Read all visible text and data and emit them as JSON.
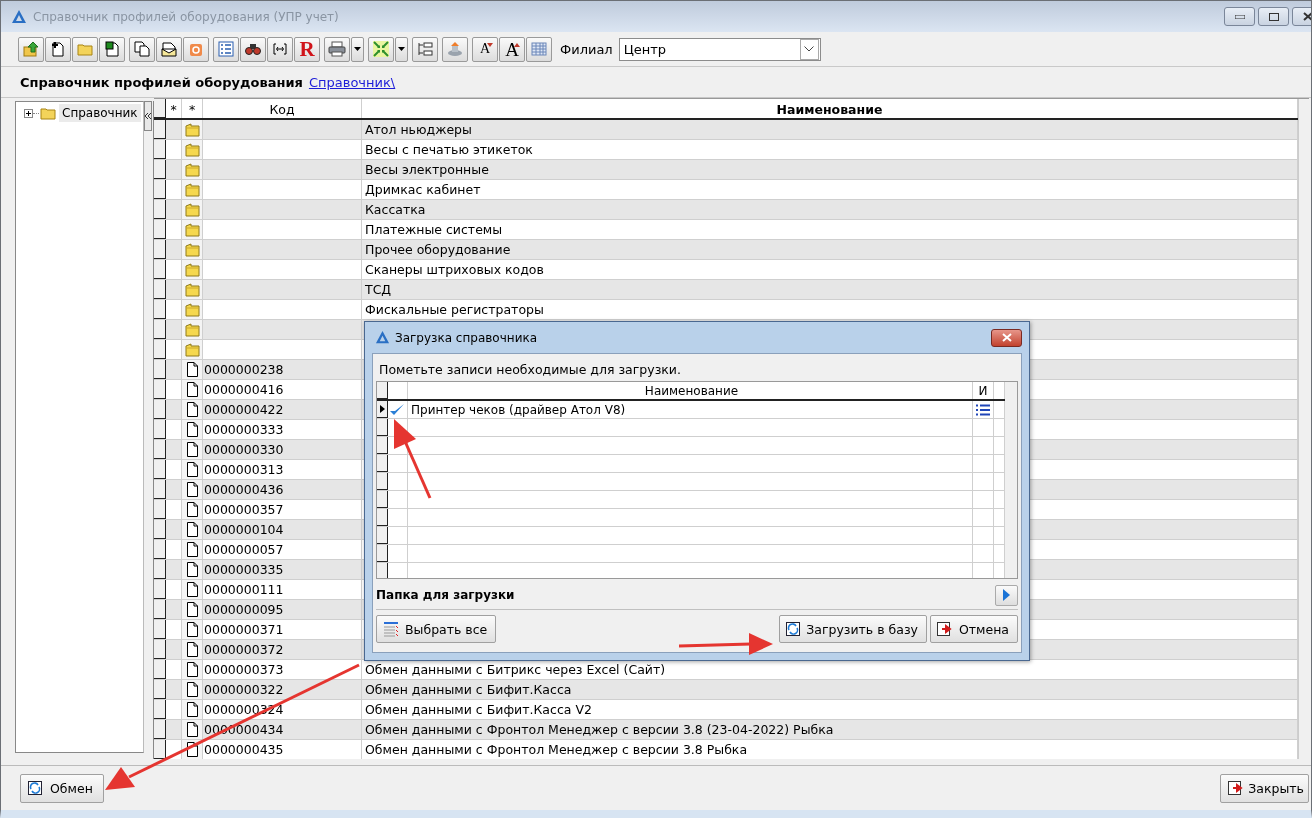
{
  "window": {
    "title": "Справочник профилей оборудования (УПР учет)"
  },
  "toolbar": {
    "groups": [
      [
        {
          "kind": "up"
        },
        {
          "kind": "new"
        },
        {
          "kind": "folder"
        },
        {
          "kind": "save"
        }
      ],
      [
        {
          "kind": "copy"
        },
        {
          "kind": "mail"
        },
        {
          "kind": "delete"
        }
      ],
      [
        {
          "kind": "list"
        },
        {
          "kind": "binoculars"
        },
        {
          "kind": "brackets"
        },
        {
          "kind": "letter",
          "label": "R"
        }
      ],
      [
        {
          "kind": "print",
          "dropdown": true
        }
      ],
      [
        {
          "kind": "arrows",
          "dropdown": true
        }
      ],
      [
        {
          "kind": "tree"
        }
      ],
      [
        {
          "kind": "stamp"
        }
      ],
      [
        {
          "kind": "font-down",
          "label": "A"
        },
        {
          "kind": "font-up",
          "label": "A"
        },
        {
          "kind": "grid"
        }
      ]
    ],
    "filter_label": "Филиал",
    "filter_value": "Центр"
  },
  "heading": {
    "title": "Справочник профилей оборудования",
    "link": "Справочник\\"
  },
  "tree": {
    "items": [
      {
        "label": "Справочник",
        "expanded": false,
        "selected": true
      }
    ]
  },
  "table": {
    "columns": [
      "*",
      "*",
      "Код",
      "Наименование"
    ],
    "rows": [
      {
        "kind": "folder",
        "name": "Атол ньюджеры"
      },
      {
        "kind": "folder",
        "name": "Весы с печатью этикеток"
      },
      {
        "kind": "folder",
        "name": "Весы электронные"
      },
      {
        "kind": "folder",
        "name": "Дримкас кабинет"
      },
      {
        "kind": "folder",
        "name": "Кассатка"
      },
      {
        "kind": "folder",
        "name": "Платежные системы"
      },
      {
        "kind": "folder",
        "name": "Прочее оборудование"
      },
      {
        "kind": "folder",
        "name": "Сканеры штриховых кодов"
      },
      {
        "kind": "folder",
        "name": "ТСД"
      },
      {
        "kind": "folder",
        "name": "Фискальные регистраторы"
      },
      {
        "kind": "folder"
      },
      {
        "kind": "folder"
      },
      {
        "kind": "item",
        "code": "0000000238"
      },
      {
        "kind": "item",
        "code": "0000000416"
      },
      {
        "kind": "item",
        "code": "0000000422"
      },
      {
        "kind": "item",
        "code": "0000000333"
      },
      {
        "kind": "item",
        "code": "0000000330"
      },
      {
        "kind": "item",
        "code": "0000000313"
      },
      {
        "kind": "item",
        "code": "0000000436"
      },
      {
        "kind": "item",
        "code": "0000000357"
      },
      {
        "kind": "item",
        "code": "0000000104"
      },
      {
        "kind": "item",
        "code": "0000000057"
      },
      {
        "kind": "item",
        "code": "0000000335"
      },
      {
        "kind": "item",
        "code": "0000000111"
      },
      {
        "kind": "item",
        "code": "0000000095"
      },
      {
        "kind": "item",
        "code": "0000000371"
      },
      {
        "kind": "item",
        "code": "0000000372"
      },
      {
        "kind": "item",
        "code": "0000000373",
        "name": "Обмен данными с Битрикс через Excel (Сайт)"
      },
      {
        "kind": "item",
        "code": "0000000322",
        "name": "Обмен данными с Бифит.Касса"
      },
      {
        "kind": "item",
        "code": "0000000324",
        "name": "Обмен данными с Бифит.Касса V2"
      },
      {
        "kind": "item",
        "code": "0000000434",
        "name": "Обмен данными с Фронтол Менеджер с версии 3.8 (23-04-2022) Рыбка"
      },
      {
        "kind": "item",
        "code": "0000000435",
        "name": "Обмен данными с Фронтол Менеджер с версии 3.8 Рыбка"
      }
    ]
  },
  "bottom_buttons": [
    "Обмен",
    "Закрыть"
  ],
  "dialog": {
    "title": "Загрузка справочника",
    "instruction": "Пометьте записи необходимые для загрузки.",
    "columns": [
      "Наименование",
      "И"
    ],
    "rows": [
      {
        "name": "Принтер чеков (драйвер Атол V8)",
        "checked": true,
        "selected": true
      }
    ],
    "folder_label": "Папка для загрузки",
    "buttons": [
      "Выбрать все",
      "Загрузить в базу",
      "Отмена"
    ]
  }
}
